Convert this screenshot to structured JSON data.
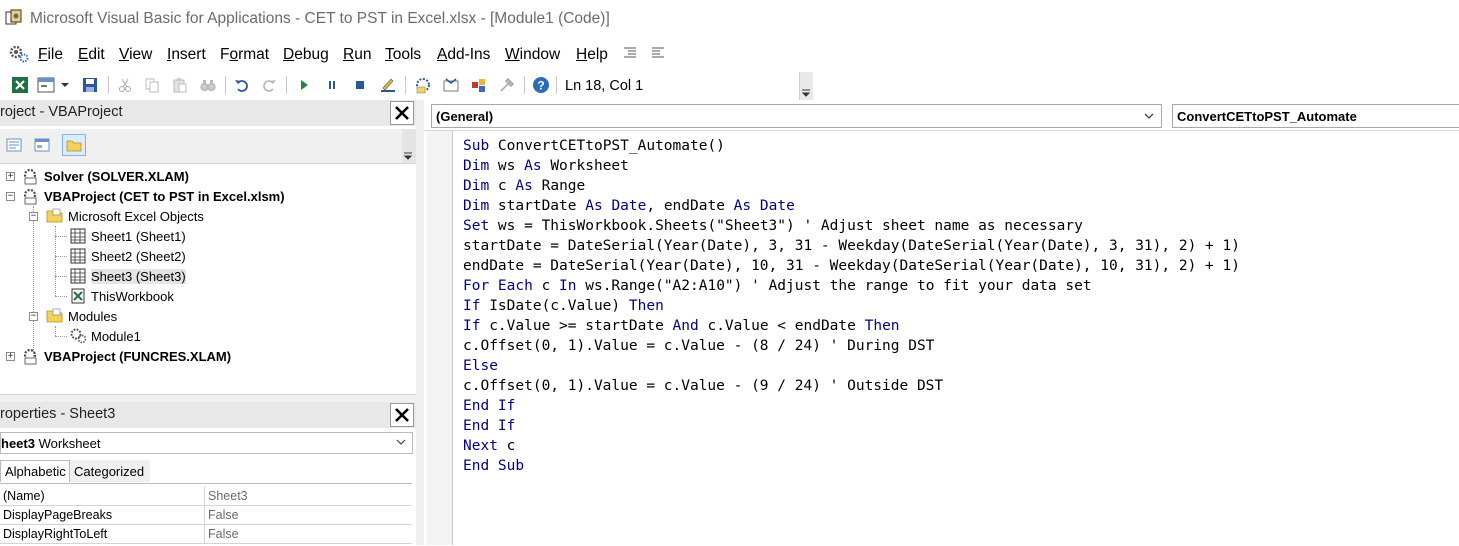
{
  "window": {
    "title": "Microsoft Visual Basic for Applications - CET to PST in Excel.xlsx - [Module1 (Code)]"
  },
  "menu": {
    "items": [
      {
        "acc": "F",
        "rest": "ile"
      },
      {
        "acc": "E",
        "rest": "dit"
      },
      {
        "acc": "V",
        "rest": "iew"
      },
      {
        "acc": "I",
        "rest": "nsert"
      },
      {
        "pre": "F",
        "acc": "o",
        "rest": "rmat"
      },
      {
        "acc": "D",
        "rest": "ebug"
      },
      {
        "acc": "R",
        "rest": "un"
      },
      {
        "acc": "T",
        "rest": "ools"
      },
      {
        "acc": "A",
        "rest": "dd-Ins"
      },
      {
        "acc": "W",
        "rest": "indow"
      },
      {
        "acc": "H",
        "rest": "elp"
      }
    ]
  },
  "toolbar": {
    "position": "Ln 18, Col 1"
  },
  "project": {
    "title": "roject - VBAProject",
    "tree": {
      "solver": "Solver (SOLVER.XLAM)",
      "vbaproject": "VBAProject (CET to PST in Excel.xlsm)",
      "excel_objects": "Microsoft Excel Objects",
      "sheet1": "Sheet1 (Sheet1)",
      "sheet2": "Sheet2 (Sheet2)",
      "sheet3": "Sheet3 (Sheet3)",
      "thisworkbook": "ThisWorkbook",
      "modules": "Modules",
      "module1": "Module1",
      "funcres": "VBAProject (FUNCRES.XLAM)"
    }
  },
  "properties": {
    "title": "roperties - Sheet3",
    "object_name": "heet3",
    "object_type": "Worksheet",
    "tabs": [
      "Alphabetic",
      "Categorized"
    ],
    "rows": [
      {
        "name": "(Name)",
        "value": "Sheet3"
      },
      {
        "name": "DisplayPageBreaks",
        "value": "False"
      },
      {
        "name": "DisplayRightToLeft",
        "value": "False"
      }
    ]
  },
  "code": {
    "object_combo": "(General)",
    "procedure_combo": "ConvertCETtoPST_Automate",
    "lines": [
      [
        {
          "k": "Sub"
        },
        {
          "t": " ConvertCETtoPST_Automate()"
        }
      ],
      [
        {
          "k": "Dim"
        },
        {
          "t": " ws "
        },
        {
          "k": "As"
        },
        {
          "t": " Worksheet"
        }
      ],
      [
        {
          "k": "Dim"
        },
        {
          "t": " c "
        },
        {
          "k": "As"
        },
        {
          "t": " Range"
        }
      ],
      [
        {
          "k": "Dim"
        },
        {
          "t": " startDate "
        },
        {
          "k": "As"
        },
        {
          "t": " "
        },
        {
          "k": "Date"
        },
        {
          "t": ", endDate "
        },
        {
          "k": "As"
        },
        {
          "t": " "
        },
        {
          "k": "Date"
        }
      ],
      [
        {
          "k": "Set"
        },
        {
          "t": " ws = ThisWorkbook.Sheets(\"Sheet3\") ' Adjust sheet name as necessary"
        }
      ],
      [
        {
          "t": "startDate = DateSerial(Year(Date), 3, 31 - Weekday(DateSerial(Year(Date), 3, 31), 2) + 1)"
        }
      ],
      [
        {
          "t": "endDate = DateSerial(Year(Date), 10, 31 - Weekday(DateSerial(Year(Date), 10, 31), 2) + 1)"
        }
      ],
      [
        {
          "k": "For Each"
        },
        {
          "t": " c "
        },
        {
          "k": "In"
        },
        {
          "t": " ws.Range(\"A2:A10\") ' Adjust the range to fit your data set"
        }
      ],
      [
        {
          "k": "If"
        },
        {
          "t": " IsDate(c.Value) "
        },
        {
          "k": "Then"
        }
      ],
      [
        {
          "k": "If"
        },
        {
          "t": " c.Value >= startDate "
        },
        {
          "k": "And"
        },
        {
          "t": " c.Value < endDate "
        },
        {
          "k": "Then"
        }
      ],
      [
        {
          "t": "c.Offset(0, 1).Value = c.Value - (8 / 24) ' During DST"
        }
      ],
      [
        {
          "k": "Else"
        }
      ],
      [
        {
          "t": "c.Offset(0, 1).Value = c.Value - (9 / 24) ' Outside DST"
        }
      ],
      [
        {
          "k": "End If"
        }
      ],
      [
        {
          "k": "End If"
        }
      ],
      [
        {
          "k": "Next"
        },
        {
          "t": " c"
        }
      ],
      [
        {
          "k": "End Sub"
        }
      ]
    ]
  },
  "icons": {
    "app": "vba-app-icon",
    "close": "close-icon",
    "dropdown": "chevron-down-icon"
  },
  "colors": {
    "keyword": "#00008b",
    "pane_header": "#e8e8e8"
  }
}
